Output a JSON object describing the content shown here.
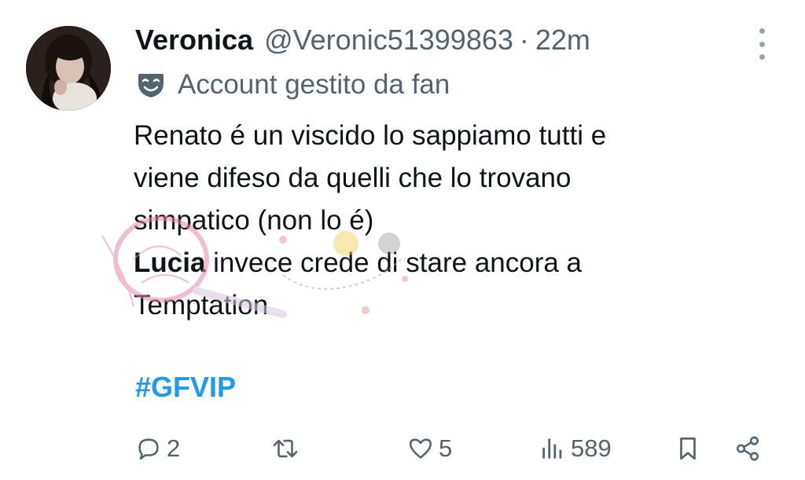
{
  "tweet": {
    "display_name": "Veronica",
    "handle": "@Veronic51399863",
    "separator": "·",
    "time": "22m",
    "label_icon": "theater-mask-icon",
    "label": "Account gestito da fan",
    "lines": [
      "Renato é un viscido lo sappiamo tutti e",
      "viene difeso da quelli che lo trovano",
      "simpatico (non lo é)"
    ],
    "line4_bold": "Lucia",
    "line4_rest": " invece crede di stare ancora a",
    "line5": "Temptation",
    "hashtag": "#GFVIP"
  },
  "actions": {
    "reply": {
      "icon": "reply-icon",
      "count": "2"
    },
    "retweet": {
      "icon": "retweet-icon",
      "count": ""
    },
    "like": {
      "icon": "heart-icon",
      "count": "5"
    },
    "views": {
      "icon": "views-icon",
      "count": "589"
    },
    "bookmark": {
      "icon": "bookmark-icon"
    },
    "share": {
      "icon": "share-icon"
    }
  },
  "colors": {
    "text": "#0f1419",
    "secondary": "#536471",
    "hashtag": "#1d9bf0",
    "watermark_pink": "#e88aa8"
  }
}
